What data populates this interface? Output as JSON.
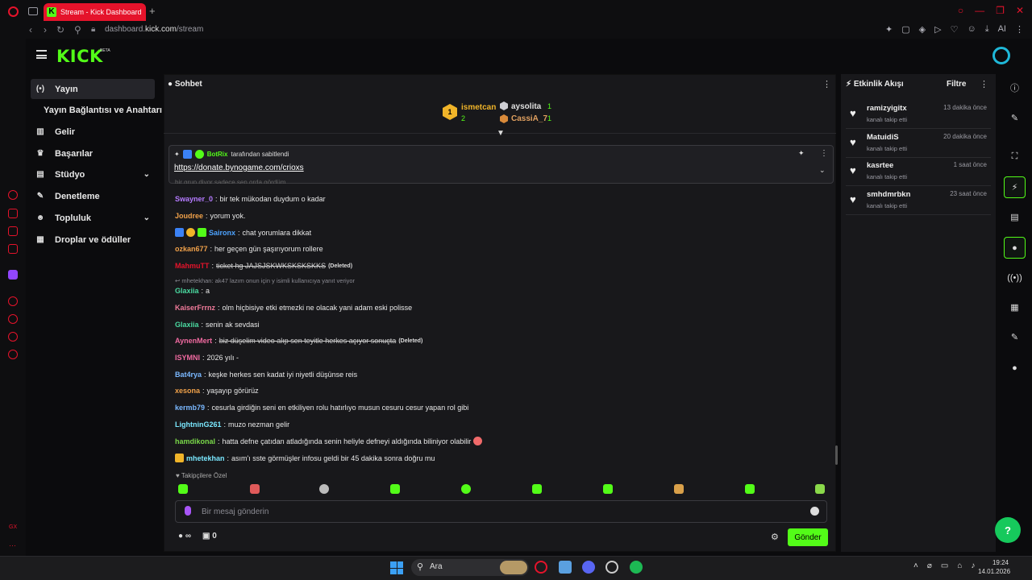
{
  "browser": {
    "tab_title": "Stream - Kick Dashboard",
    "tab_favicon": "K",
    "new_tab": "+",
    "url_prefix": "dashboard.",
    "url_domain": "kick.com",
    "url_path": "/stream",
    "ext_ai_label": "AI",
    "brand_red": "#e5132b"
  },
  "header": {
    "logo": "KICK",
    "beta": "BETA",
    "brand_green": "#53fc18"
  },
  "nav": {
    "items": [
      {
        "label": "Yayın",
        "icon": "live-icon"
      },
      {
        "label": "Yayın Bağlantısı ve Anahtarı"
      },
      {
        "label": "Gelir",
        "icon": "chart-icon"
      },
      {
        "label": "Başarılar",
        "icon": "trophy-icon"
      },
      {
        "label": "Stüdyo",
        "icon": "studio-icon"
      },
      {
        "label": "Denetleme",
        "icon": "wrench-icon"
      },
      {
        "label": "Topluluk",
        "icon": "community-icon"
      },
      {
        "label": "Droplar ve ödüller",
        "icon": "gift-icon"
      }
    ]
  },
  "chat": {
    "title": "Sohbet",
    "leaderboard": {
      "first": {
        "rank": "1",
        "name": "ismetcan",
        "count": "2"
      },
      "second": {
        "name": "aysolita",
        "count": "1"
      },
      "third": {
        "name": "CassiA_7",
        "count": "1"
      }
    },
    "pinned": {
      "author": "BotRix",
      "suffix": "tarafından sabitlendi",
      "link": "https://donate.bynogame.com/crioxs"
    },
    "partial_line": "bir grup diyor sadece sen orda gördüm",
    "messages": [
      {
        "user": "Swayner_0",
        "color": "#b57bff",
        "text": "bir tek mükodan duydum o kadar"
      },
      {
        "user": "Joudree",
        "color": "#f0a14a",
        "text": "yorum yok."
      },
      {
        "user": "Saironx",
        "color": "#4da3ff",
        "text": "chat yorumlara dikkat"
      },
      {
        "user": "ozkan677",
        "color": "#f0a14a",
        "text": "her geçen gün şaşırıyorum rollere"
      },
      {
        "user": "MahmuTT",
        "color": "#e5132b",
        "text": "ticket hg JAJSJSKWKSKSKSKKS",
        "deleted": "(Deleted)"
      },
      {
        "reply": "mhetekhan: ak47 lazım onun için y isimli kullanıcıya yanıt veriyor"
      },
      {
        "user": "Glaxiia",
        "color": "#4ad9a0",
        "text": "a"
      },
      {
        "user": "KaiserFrrnz",
        "color": "#f07a9a",
        "text": "olm hiçbisiye etki etmezki ne olacak yani adam eski polisse"
      },
      {
        "user": "Glaxiia",
        "color": "#4ad9a0",
        "text": "senin ak sevdasi"
      },
      {
        "user": "AynenMert",
        "color": "#f06aa0",
        "text": "biz düşelim video alıp sen teyitle herkes açıyor sonuçta",
        "deleted": "(Deleted)"
      },
      {
        "user": "ISYMNI",
        "color": "#f06aa0",
        "text": "2026 yılı -"
      },
      {
        "user": "Bat4rya",
        "color": "#7ab8ff",
        "text": "keşke herkes sen kadat iyi niyetli düşünse reis"
      },
      {
        "user": "xesona",
        "color": "#f0a14a",
        "text": "yaşayıp görürüz"
      },
      {
        "user": "kermb79",
        "color": "#7ab8ff",
        "text": "cesurla girdiğin seni en etkiliyen rolu hatırlıyo musun cesuru cesur yapan rol gibi"
      },
      {
        "user": "LightninG261",
        "color": "#7ae8ff",
        "text": "muzo nezman gelir"
      },
      {
        "user": "hamdikonal",
        "color": "#7ad94a",
        "text": "hatta defne çatıdan atladığında senin heliyle defneyi aldığında biliniyor olabilir"
      },
      {
        "user": "mhetekhan",
        "color": "#7ae8ff",
        "text": "asım'ı sste görmüşler infosu geldi bir 45 dakika sonra doğru mu"
      }
    ],
    "follow_only": "Takipçilere Özel",
    "input_placeholder": "Bir mesaj gönderin",
    "infinity_label": "∞",
    "store_count": "0",
    "send_label": "Gönder"
  },
  "activity": {
    "title": "Etkinlik Akışı",
    "filter": "Filtre",
    "events": [
      {
        "name": "ramizyigitx",
        "sub": "kanalı takip etti",
        "time": "13 dakika önce"
      },
      {
        "name": "MatuidiS",
        "sub": "kanalı takip etti",
        "time": "20 dakika önce"
      },
      {
        "name": "kasrtee",
        "sub": "kanalı takip etti",
        "time": "1 saat önce"
      },
      {
        "name": "smhdmrbkn",
        "sub": "kanalı takip etti",
        "time": "23 saat önce"
      }
    ]
  },
  "taskbar": {
    "search_label": "Ara",
    "time": "19:24",
    "date": "14.01.2026"
  },
  "sidebar": {
    "gx_label": "GX",
    "more_label": "···"
  }
}
